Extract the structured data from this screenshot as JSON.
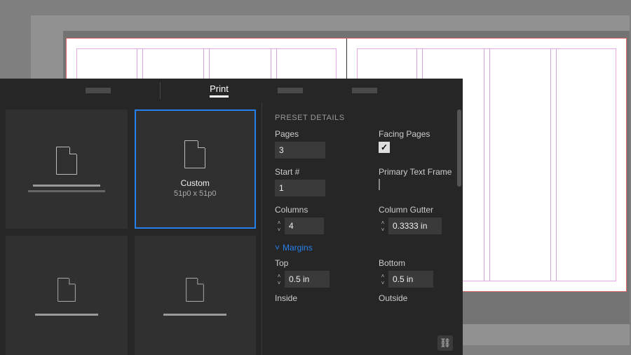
{
  "document": {
    "columns_per_page": 4
  },
  "dialog": {
    "active_tab": "Print",
    "presets": {
      "selected": {
        "label": "Custom",
        "sub": "51p0 x 51p0"
      }
    },
    "details": {
      "heading": "PRESET DETAILS",
      "pages": {
        "label": "Pages",
        "value": "3"
      },
      "facing": {
        "label": "Facing Pages",
        "checked": true
      },
      "start": {
        "label": "Start #",
        "value": "1"
      },
      "ptf": {
        "label": "Primary Text Frame",
        "checked": false
      },
      "columns": {
        "label": "Columns",
        "value": "4"
      },
      "gutter": {
        "label": "Column Gutter",
        "value": "0.3333 in"
      },
      "margins_section": "Margins",
      "top": {
        "label": "Top",
        "value": "0.5 in"
      },
      "bottom": {
        "label": "Bottom",
        "value": "0.5 in"
      },
      "inside": {
        "label": "Inside"
      },
      "outside": {
        "label": "Outside"
      }
    }
  }
}
